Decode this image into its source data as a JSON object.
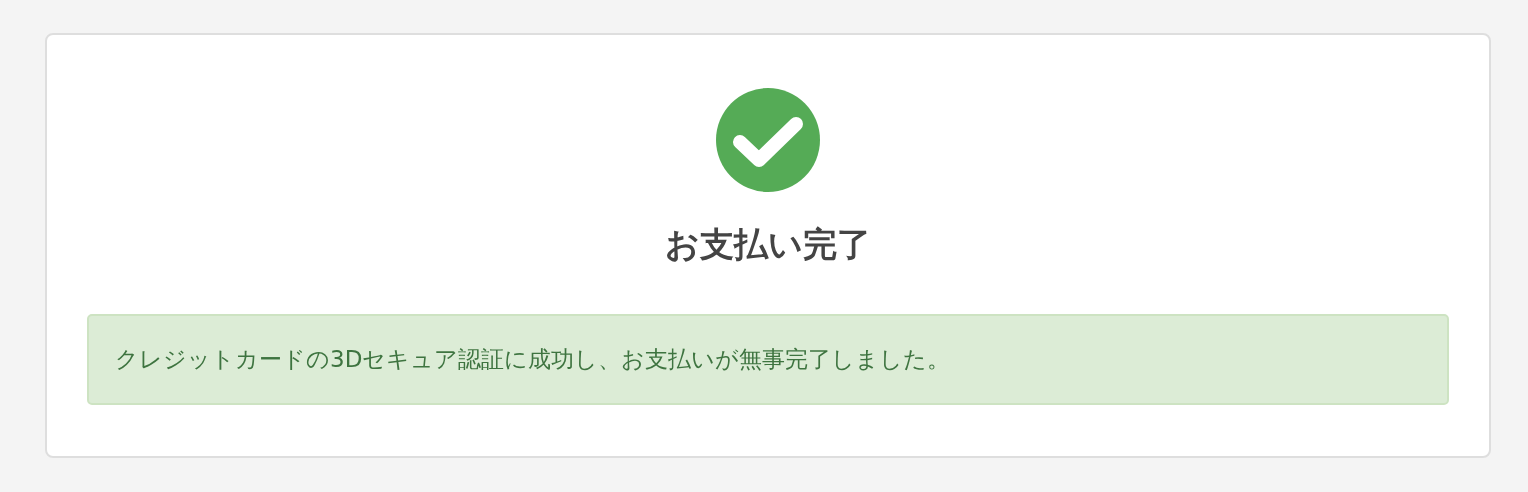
{
  "title": "お支払い完了",
  "message": "クレジットカードの3Dセキュア認証に成功し、お支払いが無事完了しました。"
}
